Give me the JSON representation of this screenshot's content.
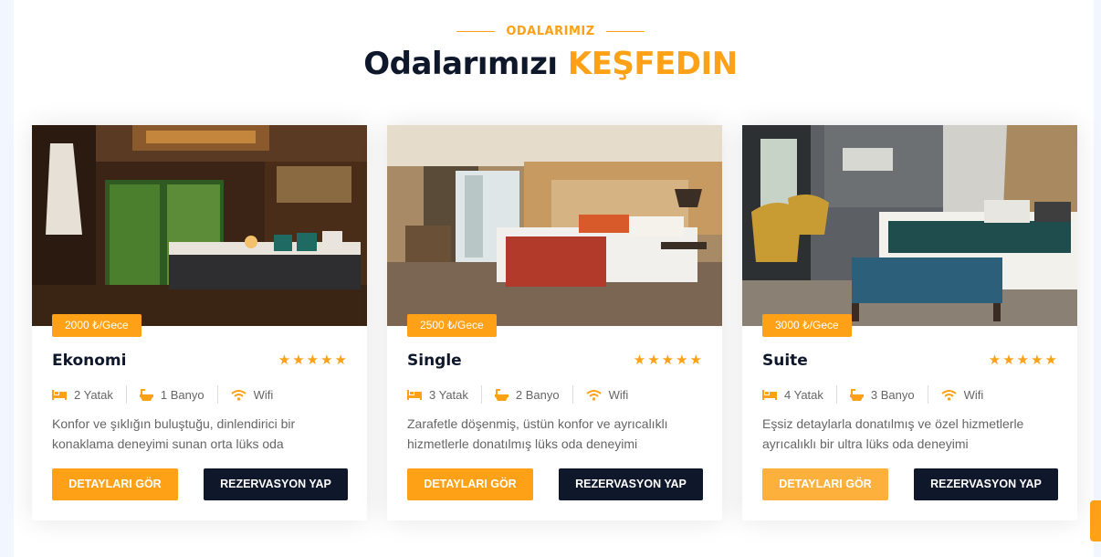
{
  "section": {
    "subtitle": "ODALARIMIZ",
    "title_main": "Odalarımızı",
    "title_accent": "KEŞFEDIN"
  },
  "rooms": [
    {
      "price": "2000 ₺/Gece",
      "name": "Ekonomi",
      "rating": 5,
      "beds": "2 Yatak",
      "baths": "1 Banyo",
      "wifi": "Wifi",
      "description": "Konfor ve şıklığın buluştuğu, dinlendirici bir konaklama deneyimi sunan orta lüks oda",
      "details_label": "DETAYLARI GÖR",
      "reserve_label": "REZERVASYON YAP"
    },
    {
      "price": "2500 ₺/Gece",
      "name": "Single",
      "rating": 5,
      "beds": "3 Yatak",
      "baths": "2 Banyo",
      "wifi": "Wifi",
      "description": "Zarafetle döşenmiş, üstün konfor ve ayrıcalıklı hizmetlerle donatılmış lüks oda deneyimi",
      "details_label": "DETAYLARI GÖR",
      "reserve_label": "REZERVASYON YAP"
    },
    {
      "price": "3000 ₺/Gece",
      "name": "Suite",
      "rating": 5,
      "beds": "4 Yatak",
      "baths": "3 Banyo",
      "wifi": "Wifi",
      "description": "Eşsiz detaylarla donatılmış ve özel hizmetlerle ayrıcalıklı bir ultra lüks oda deneyimi",
      "details_label": "DETAYLARI GÖR",
      "reserve_label": "REZERVASYON YAP"
    }
  ],
  "colors": {
    "accent": "#fea116",
    "dark": "#0f172b",
    "text": "#666565"
  },
  "icons": {
    "bed": "bed-icon",
    "bath": "bath-icon",
    "wifi": "wifi-icon",
    "star": "star-icon"
  }
}
